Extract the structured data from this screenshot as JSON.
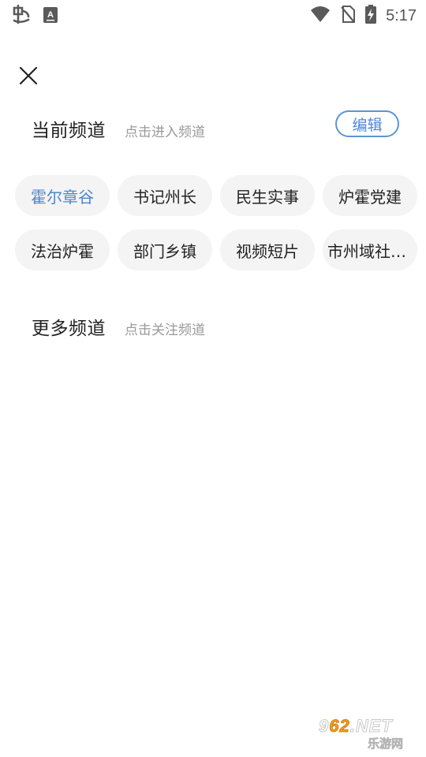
{
  "status_bar": {
    "time": "5:17",
    "icons": [
      "app-logo-icon",
      "keyboard-a-icon",
      "wifi-icon",
      "no-sim-icon",
      "battery-charging-icon"
    ]
  },
  "close": {
    "icon": "close-icon"
  },
  "current_channels": {
    "title": "当前频道",
    "subtitle": "点击进入频道",
    "edit_label": "编辑",
    "accent_color": "#4c88cf",
    "items": [
      {
        "label": "霍尔章谷",
        "active": true
      },
      {
        "label": "书记州长",
        "active": false
      },
      {
        "label": "民生实事",
        "active": false
      },
      {
        "label": "炉霍党建",
        "active": false
      },
      {
        "label": "法治炉霍",
        "active": false
      },
      {
        "label": "部门乡镇",
        "active": false
      },
      {
        "label": "视频短片",
        "active": false
      },
      {
        "label": "市州域社会…",
        "active": false
      }
    ]
  },
  "more_channels": {
    "title": "更多频道",
    "subtitle": "点击关注频道"
  },
  "watermark": {
    "line1_prefix": "9",
    "line1_accent": "62",
    "line1_suffix": ".NET",
    "line2": "乐游网"
  }
}
